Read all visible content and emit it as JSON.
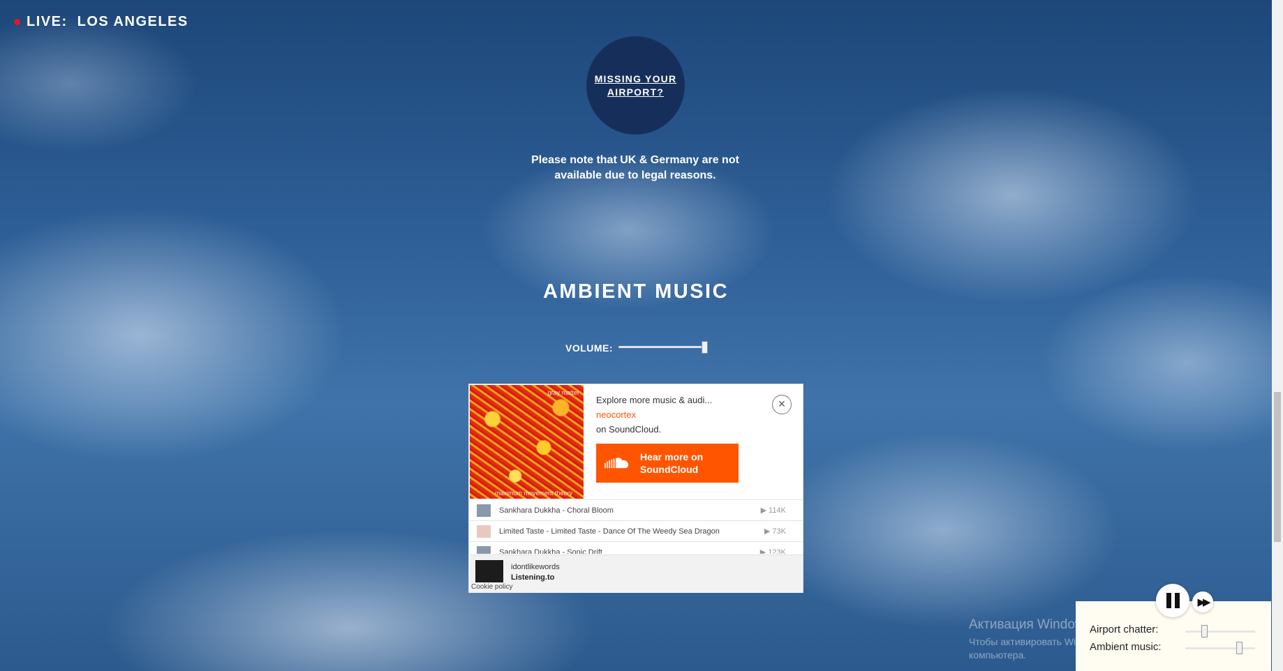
{
  "header": {
    "live_label": "LIVE:",
    "city": "LOS ANGELES"
  },
  "missing_airport": {
    "label": "MISSING YOUR AIRPORT?"
  },
  "legal_note": "Please note that UK & Germany are not available due to legal reasons.",
  "ambient": {
    "title": "AMBIENT MUSIC",
    "volume_label": "VOLUME:",
    "volume_level": 1.0
  },
  "soundcloud": {
    "art_caption_top": "gray matter",
    "art_caption_bottom": "maximum movement theory",
    "explore_text": "Explore more music & audi...",
    "artist": "neocortex",
    "on_platform": "on SoundCloud.",
    "hear_more": "Hear more on SoundCloud",
    "close_icon": "close-icon",
    "tracks": [
      {
        "title": "Sankhara Dukkha - Choral Bloom",
        "plays": "114K"
      },
      {
        "title": "Limited Taste - Limited Taste - Dance Of The Weedy Sea Dragon",
        "plays": "73K"
      },
      {
        "title": "Sankhara Dukkha - Sonic Drift",
        "plays": "123K"
      }
    ],
    "footer": {
      "user": "idontlikewords",
      "site": "Listening.to",
      "cookie": "Cookie policy"
    }
  },
  "watermark": {
    "line1": "Активация Windows",
    "line2": "Чтобы активировать Windows, перейдите к параметрам компьютера."
  },
  "controls": {
    "airport_chatter_label": "Airport chatter:",
    "ambient_music_label": "Ambient music:",
    "airport_chatter_level": 0.25,
    "ambient_music_level": 0.8
  },
  "colors": {
    "accent": "#ff5500",
    "live_dot": "#e0182b",
    "circle": "#162f5a"
  }
}
